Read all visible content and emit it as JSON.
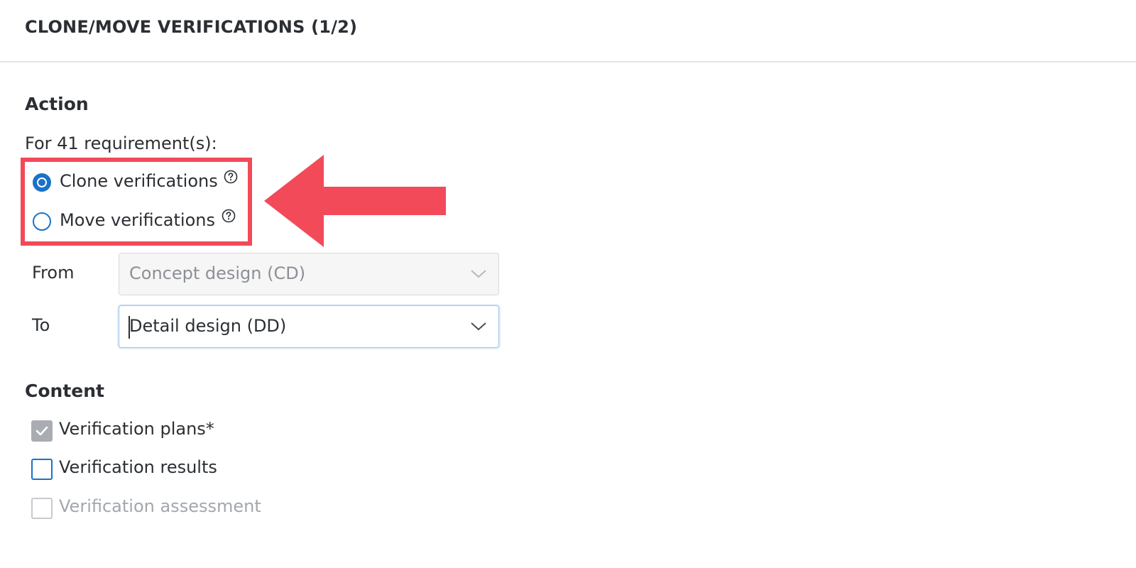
{
  "dialog": {
    "title": "CLONE/MOVE VERIFICATIONS (1/2)"
  },
  "action": {
    "heading": "Action",
    "intro": "For 41 requirement(s):",
    "options": [
      {
        "label": "Clone verifications",
        "selected": true,
        "icon": "help-circle-icon"
      },
      {
        "label": "Move verifications",
        "selected": false,
        "icon": "help-circle-icon"
      }
    ],
    "from": {
      "label": "From",
      "value": "Concept design (CD)",
      "disabled": true
    },
    "to": {
      "label": "To",
      "value": "Detail design (DD)",
      "disabled": false
    }
  },
  "content": {
    "heading": "Content",
    "items": [
      {
        "label": "Verification plans*",
        "checked": true,
        "disabled": true
      },
      {
        "label": "Verification results",
        "checked": false,
        "disabled": false
      },
      {
        "label": "Verification assessment",
        "checked": false,
        "disabled": true
      }
    ]
  },
  "annotation": {
    "highlight_color": "#f24a59",
    "icon": "arrow-left-icon"
  },
  "colors": {
    "accent": "#1a73c8",
    "text": "#2b2f33",
    "muted": "#a3a7ac"
  }
}
